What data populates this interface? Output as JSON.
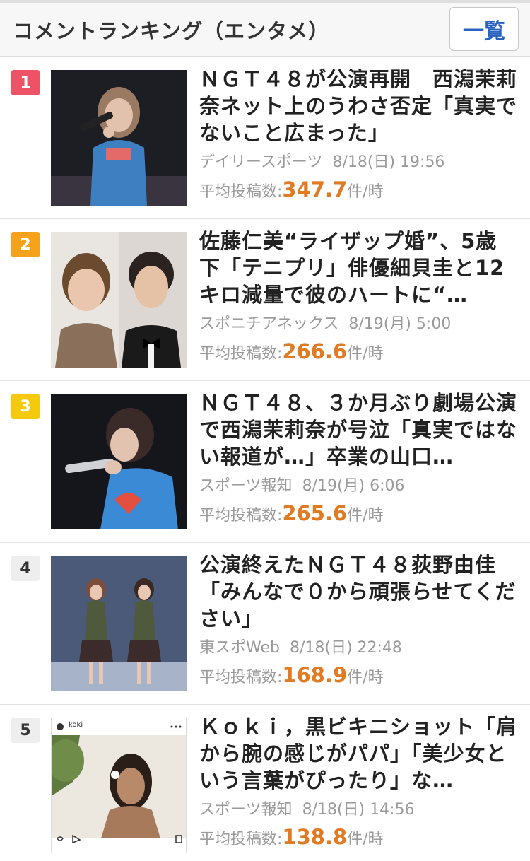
{
  "header": {
    "title": "コメントランキング（エンタメ）",
    "list_button": "一覧"
  },
  "stat_label": "平均投稿数:",
  "stat_unit": "件/時",
  "items": [
    {
      "rank": "1",
      "headline": "ＮＧＴ４８が公演再開　西潟茉莉奈ネット上のうわさ否定「真実でないこと広まった」",
      "source": "デイリースポーツ",
      "date": "8/18(日) 19:56",
      "avg_posts": "347.7"
    },
    {
      "rank": "2",
      "headline": "佐藤仁美“ライザップ婚”、5歳下「テニプリ」俳優細貝圭と12キロ減量で彼のハートに“…",
      "source": "スポニチアネックス",
      "date": "8/19(月) 5:00",
      "avg_posts": "266.6"
    },
    {
      "rank": "3",
      "headline": "ＮＧＴ４８、３か月ぶり劇場公演で西潟茉莉奈が号泣「真実ではない報道が…」卒業の山口…",
      "source": "スポーツ報知",
      "date": "8/19(月) 6:06",
      "avg_posts": "265.6"
    },
    {
      "rank": "4",
      "headline": "公演終えたＮＧＴ４８荻野由佳「みんなで０から頑張らせてください」",
      "source": "東スポWeb",
      "date": "8/18(日) 22:48",
      "avg_posts": "168.9"
    },
    {
      "rank": "5",
      "headline": "Ｋｏｋｉ，黒ビキニショット「肩から腕の感じがパパ」「美少女という言葉がぴったり」な…",
      "source": "スポーツ報知",
      "date": "8/18(日) 14:56",
      "avg_posts": "138.8"
    }
  ],
  "thumb5_caption": "koki"
}
